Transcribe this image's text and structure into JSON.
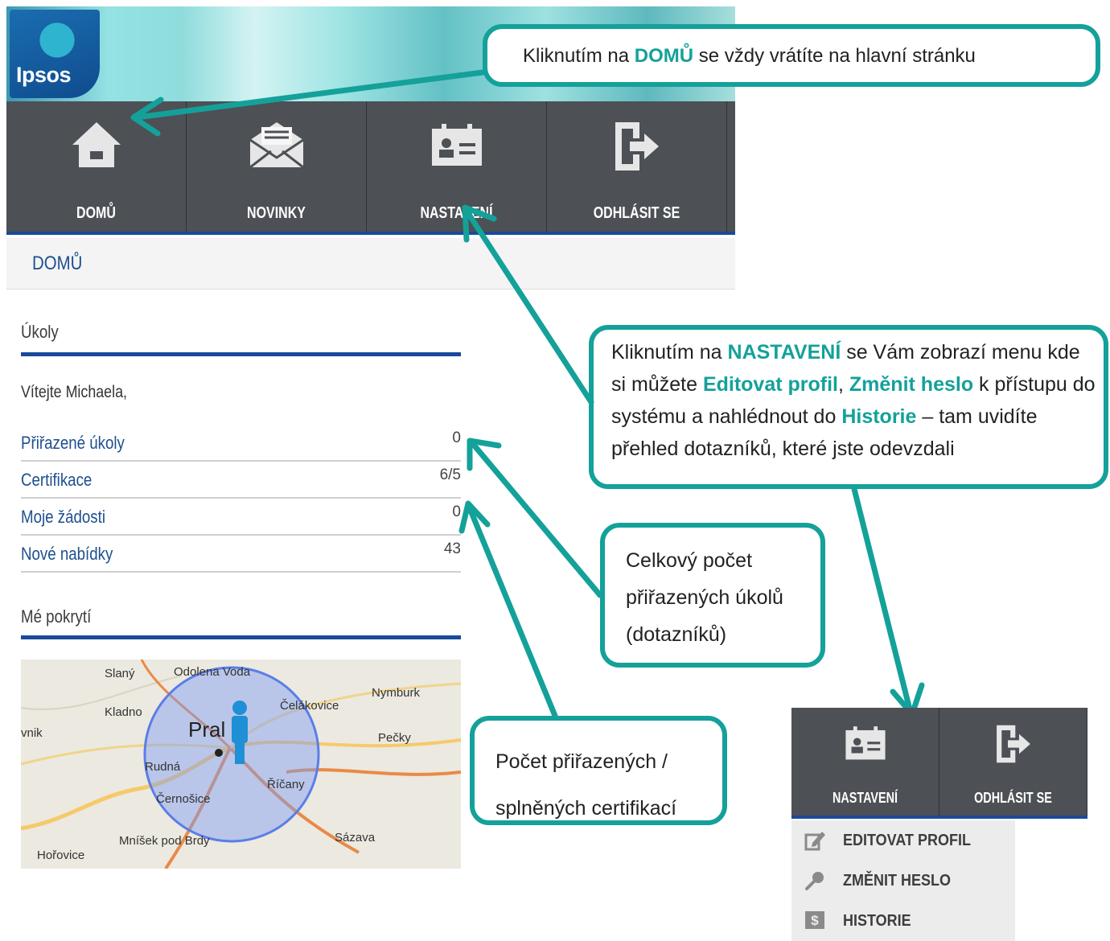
{
  "brand": {
    "logo_text": "Ipsos"
  },
  "nav": {
    "items": [
      {
        "label": "DOMŮ",
        "icon": "home-icon"
      },
      {
        "label": "NOVINKY",
        "icon": "envelope-icon"
      },
      {
        "label": "NASTAVENÍ",
        "icon": "id-card-icon"
      },
      {
        "label": "ODHLÁSIT SE",
        "icon": "logout-icon"
      }
    ]
  },
  "breadcrumb": {
    "title": "DOMŮ"
  },
  "tasks": {
    "title": "Úkoly",
    "welcome": "Vítejte Michaela,",
    "rows": [
      {
        "name": "Přiřazené úkoly",
        "count": "0"
      },
      {
        "name": "Certifikace",
        "count": "6/5"
      },
      {
        "name": "Moje žádosti",
        "count": "0"
      },
      {
        "name": "Nové nabídky",
        "count": "43"
      }
    ]
  },
  "coverage": {
    "title": "Mé pokrytí",
    "places": [
      "Slaný",
      "Odolena Voda",
      "Nymburk",
      "Kladno",
      "Čelákovice",
      "vnik",
      "Pral",
      "Pečky",
      "Rudná",
      "Říčany",
      "Černošice",
      "Mníšek pod Brdy",
      "Sázava",
      "Hořovice"
    ]
  },
  "callouts": {
    "home": {
      "before": "Kliknutím na ",
      "highlight": "DOMŮ",
      "after": " se vždy vrátíte na hlavní stránku"
    },
    "settings": {
      "p1": "Kliknutím na ",
      "h1": "NASTAVENÍ",
      "p2": " se Vám zobrazí menu kde si můžete ",
      "h2": "Editovat profil",
      "p3": ", ",
      "h3": "Změnit heslo",
      "p4": " k přístupu do systému a nahlédnout do ",
      "h4": "Historie",
      "p5": " – tam uvidíte přehled dotazníků, které jste odevzdali"
    },
    "tasks_count": "Celkový počet přiřazených úkolů (dotazníků)",
    "certs_count": "Počet přiřazených / splněných certifikací"
  },
  "menu": {
    "nav": [
      {
        "label": "NASTAVENÍ",
        "icon": "id-card-icon"
      },
      {
        "label": "ODHLÁSIT SE",
        "icon": "logout-icon"
      }
    ],
    "dropdown": [
      {
        "label": "EDITOVAT PROFIL",
        "icon": "pencil-icon"
      },
      {
        "label": "ZMĚNIT HESLO",
        "icon": "key-icon"
      },
      {
        "label": "HISTORIE",
        "icon": "dollar-icon"
      }
    ]
  },
  "colors": {
    "accent": "#14a19a",
    "nav_bg": "#4d5055",
    "brand_blue": "#1a4a9a",
    "link_blue": "#1d4f8f"
  }
}
